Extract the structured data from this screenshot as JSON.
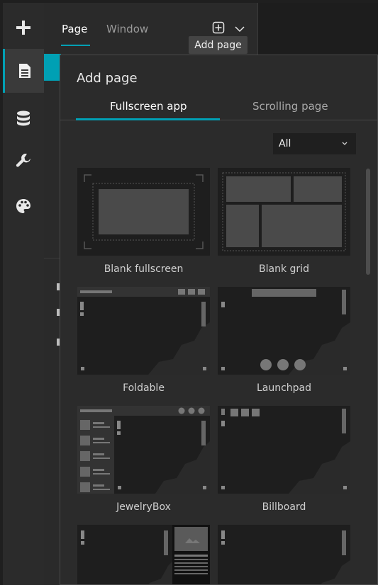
{
  "rail": {
    "items": [
      {
        "icon": "plus-icon"
      },
      {
        "icon": "page-icon",
        "active": true
      },
      {
        "icon": "database-icon"
      },
      {
        "icon": "wrench-icon"
      },
      {
        "icon": "palette-icon"
      }
    ]
  },
  "page_panel": {
    "tabs": [
      "Page",
      "Window"
    ],
    "active_tab": "Page",
    "add_page_icon": "add-page-icon",
    "dropdown_icon": "chevron-down-icon"
  },
  "tooltip": "Add page",
  "popup": {
    "title": "Add page",
    "tabs": [
      "Fullscreen app",
      "Scrolling page"
    ],
    "active_tab": "Fullscreen app",
    "filter": {
      "value": "All"
    },
    "templates": [
      {
        "label": "Blank fullscreen"
      },
      {
        "label": "Blank grid"
      },
      {
        "label": "Foldable"
      },
      {
        "label": "Launchpad"
      },
      {
        "label": "JewelryBox"
      },
      {
        "label": "Billboard"
      },
      {
        "label": ""
      },
      {
        "label": ""
      }
    ]
  },
  "colors": {
    "accent": "#00a0b4",
    "panel": "#2b2b2b",
    "tile": "#1e1e1e"
  }
}
